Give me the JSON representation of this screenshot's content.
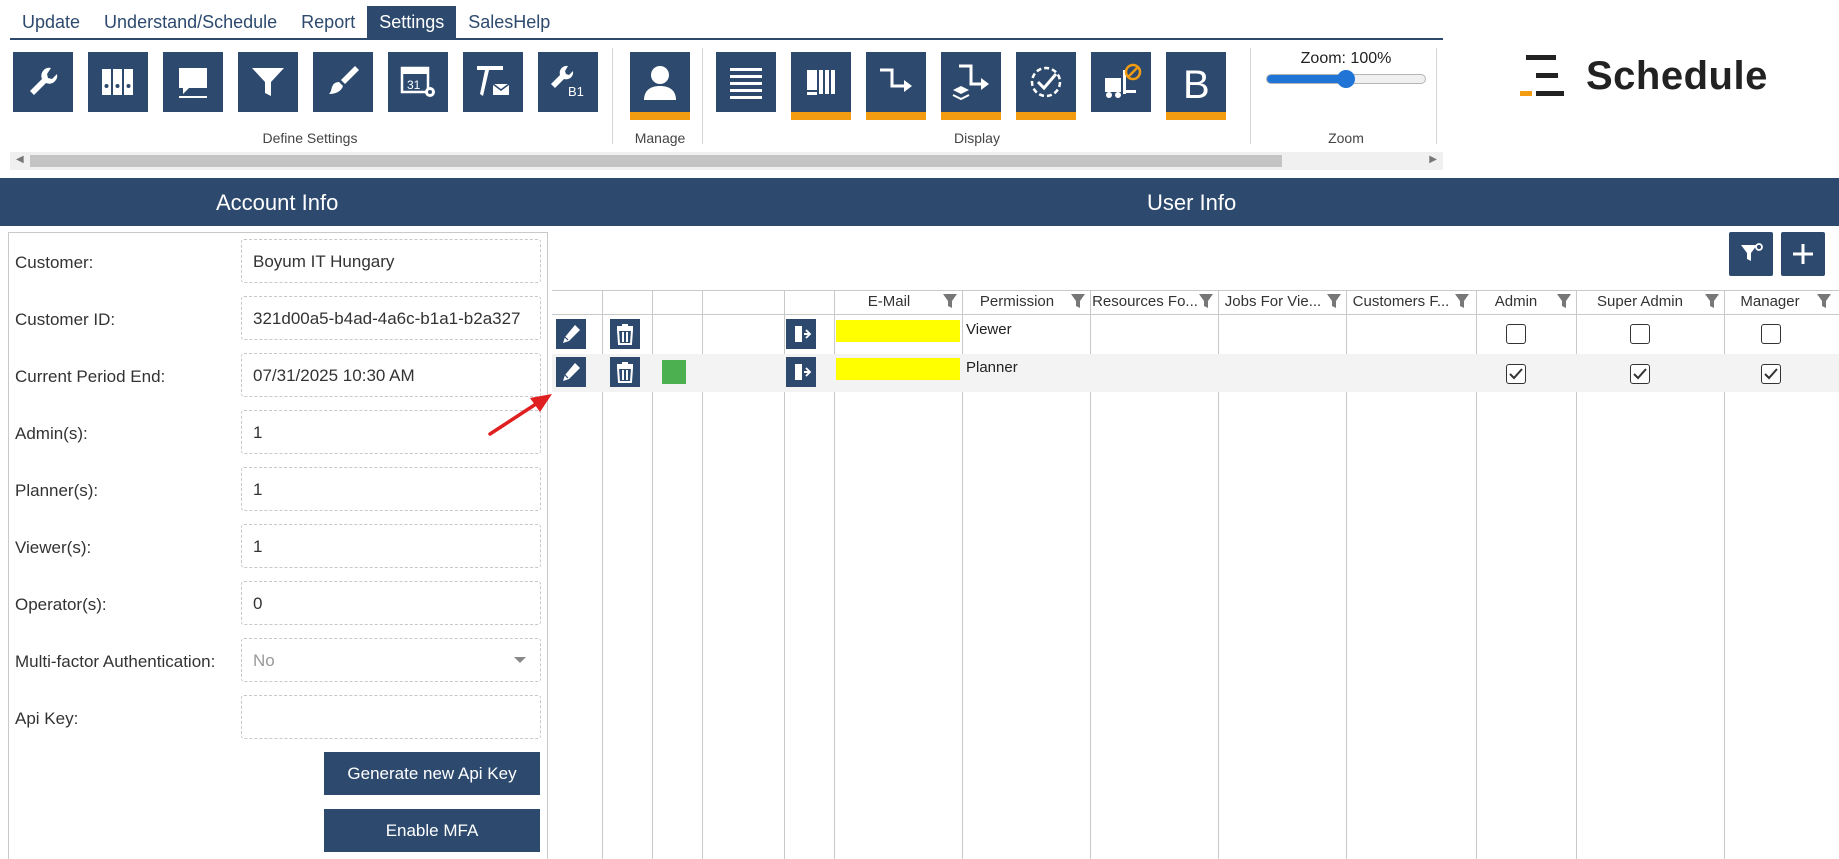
{
  "menu": {
    "tabs": [
      {
        "label": "Update",
        "active": false
      },
      {
        "label": "Understand/Schedule",
        "active": false
      },
      {
        "label": "Report",
        "active": false
      },
      {
        "label": "Settings",
        "active": true
      },
      {
        "label": "SalesHelp",
        "active": false
      }
    ]
  },
  "ribbon": {
    "groups": {
      "define_settings": "Define Settings",
      "manage": "Manage",
      "display": "Display",
      "zoom": "Zoom"
    },
    "zoom_label": "Zoom: 100%",
    "zoom_level": 0.5
  },
  "brand": {
    "name": "Schedule",
    "accent": "#f39c12"
  },
  "sections": {
    "account": "Account Info",
    "user": "User Info"
  },
  "account": {
    "customer_label": "Customer:",
    "customer_value": "Boyum IT Hungary",
    "customer_id_label": "Customer ID:",
    "customer_id_value": "321d00a5-b4ad-4a6c-b1a1-b2a327",
    "period_end_label": "Current Period End:",
    "period_end_value": "07/31/2025 10:30 AM",
    "admins_label": "Admin(s):",
    "admins_value": "1",
    "planners_label": "Planner(s):",
    "planners_value": "1",
    "viewers_label": "Viewer(s):",
    "viewers_value": "1",
    "operators_label": "Operator(s):",
    "operators_value": "0",
    "mfa_label": "Multi-factor Authentication:",
    "mfa_value": "No",
    "api_key_label": "Api Key:",
    "api_key_value": "",
    "generate_api_key_button": "Generate new Api Key",
    "enable_mfa_button": "Enable MFA"
  },
  "grid": {
    "columns": {
      "email": "E-Mail",
      "permission": "Permission",
      "resources": "Resources Fo...",
      "jobs": "Jobs For Vie...",
      "customers": "Customers F...",
      "admin": "Admin",
      "super_admin": "Super Admin",
      "manager": "Manager"
    },
    "rows": [
      {
        "permission": "Viewer",
        "admin": false,
        "super_admin": false,
        "manager": false
      },
      {
        "permission": "Planner",
        "admin": true,
        "super_admin": true,
        "manager": true
      }
    ]
  },
  "colors": {
    "primary": "#2d4a6e",
    "accent": "#f39c12",
    "highlight": "#ffff00",
    "status_green": "#4caf50",
    "arrow": "#e02020"
  }
}
